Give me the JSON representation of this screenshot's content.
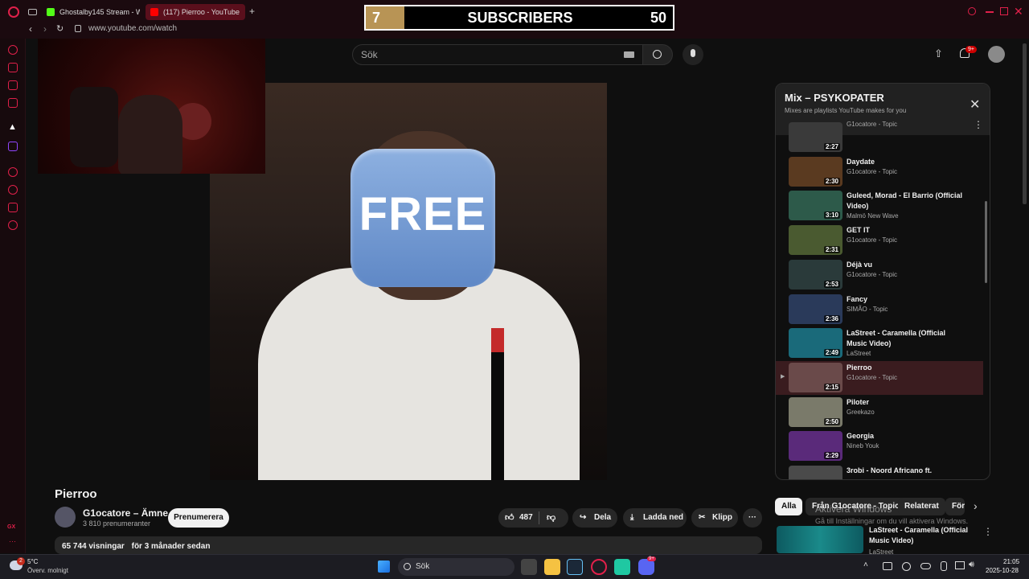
{
  "browser": {
    "tabs": [
      {
        "label": "Ghostalby145 Stream - W",
        "icon": "kick-icon"
      },
      {
        "label": "(117) Pierroo - YouTube",
        "icon": "youtube-icon"
      }
    ],
    "new_tab_label": "+",
    "url": "www.youtube.com/watch"
  },
  "overlay": {
    "count": "7",
    "label": "SUBSCRIBERS",
    "goal": "50"
  },
  "header": {
    "search_placeholder": "Sök",
    "notifications_badge": "9+"
  },
  "thumbnail": {
    "badge_text": "FREE"
  },
  "video": {
    "title": "Pierroo",
    "channel": "G1ocatore – Ämne",
    "subscribers": "3 810 prenumeranter",
    "subscribe_label": "Prenumerera",
    "likes": "487",
    "share_label": "Dela",
    "download_label": "Ladda ned",
    "clip_label": "Klipp",
    "views": "65 744 visningar",
    "date": "för 3 månader sedan"
  },
  "playlist": {
    "title": "Mix – PSYKOPATER",
    "subtitle": "Mixes are playlists YouTube makes for you",
    "items": [
      {
        "title": "",
        "artist": "G1ocatore - Topic",
        "duration": "2:27"
      },
      {
        "title": "Daydate",
        "artist": "G1ocatore - Topic",
        "duration": "2:30"
      },
      {
        "title": "Guleed, Morad - El Barrio (Official Video)",
        "artist": "Malmö New Wave",
        "duration": "3:10"
      },
      {
        "title": "GET IT",
        "artist": "G1ocatore - Topic",
        "duration": "2:31"
      },
      {
        "title": "Déjà vu",
        "artist": "G1ocatore - Topic",
        "duration": "2:53"
      },
      {
        "title": "Fancy",
        "artist": "SIMÃO - Topic",
        "duration": "2:36"
      },
      {
        "title": "LaStreet - Caramella (Official Music Video)",
        "artist": "LaStreet",
        "duration": "2:49"
      },
      {
        "title": "Pierroo",
        "artist": "G1ocatore - Topic",
        "duration": "2:15",
        "active": true
      },
      {
        "title": "Piloter",
        "artist": "Greekazo",
        "duration": "2:50"
      },
      {
        "title": "Georgia",
        "artist": "Nineb Youk",
        "duration": "2:29"
      },
      {
        "title": "3robi - Noord Africano ft.",
        "artist": "",
        "duration": ""
      }
    ]
  },
  "chips": [
    "Alla",
    "Från G1ocatore - Topic",
    "Relaterat",
    "För"
  ],
  "recommendation": {
    "title": "LaStreet - Caramella (Official Music Video)",
    "channel": "LaStreet"
  },
  "watermark": {
    "line1": "Aktivera Windows",
    "line2": "Gå till Inställningar om du vill aktivera Windows."
  },
  "taskbar": {
    "weather_temp": "5°C",
    "weather_desc": "Överv. molnigt",
    "weather_badge": "2",
    "search_label": "Sök",
    "time": "21:05",
    "date": "2025-10-28",
    "discord_badge": "9+"
  },
  "colors": {
    "accent": "#e0204a",
    "yt_red": "#ff0000",
    "overlay_gold": "#b89455"
  }
}
